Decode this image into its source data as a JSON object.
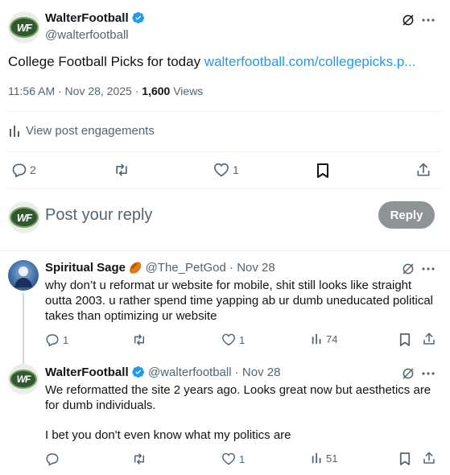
{
  "main_post": {
    "display_name": "WalterFootball",
    "handle": "@walterfootball",
    "avatar_text": "WF",
    "text": "College Football Picks for today",
    "link_text": "walterfootball.com/collegepicks.p...",
    "timestamp": "11:56 AM · Nov 28, 2025 ·",
    "views_count": "1,600",
    "views_label": "Views",
    "engagements_label": "View post engagements",
    "replies": "2",
    "reposts": "",
    "likes": "1"
  },
  "composer": {
    "placeholder": "Post your reply",
    "reply_button": "Reply",
    "avatar_text": "WF"
  },
  "replies": [
    {
      "display_name": "Spiritual Sage",
      "emoji": "🏉",
      "handle": "@The_PetGod",
      "date": "· Nov 28",
      "text": "why don’t u reformat ur website for mobile, shit still looks like straight outta 2003. u rather spend time yapping ab ur dumb uneducated political takes than optimizing ur website",
      "replies": "1",
      "reposts": "",
      "likes": "1",
      "views": "74"
    },
    {
      "display_name": "WalterFootball",
      "handle": "@walterfootball",
      "date": "· Nov 28",
      "text_line1": "We reformatted the site 2 years ago. Looks great now but aesthetics are for dumb individuals.",
      "text_line2": "I bet you don't even know what my politics are",
      "replies": "",
      "reposts": "",
      "likes": "1",
      "views": "51",
      "avatar_text": "WF"
    }
  ],
  "icons": [
    "verified-icon",
    "grok-icon",
    "more-icon",
    "reply-icon",
    "repost-icon",
    "like-icon",
    "bookmark-icon",
    "share-icon",
    "analytics-icon"
  ],
  "colors": {
    "accent": "#1d9bf0",
    "muted": "#536471",
    "divider": "#eff3f4",
    "reply_button": "#8e9396"
  }
}
